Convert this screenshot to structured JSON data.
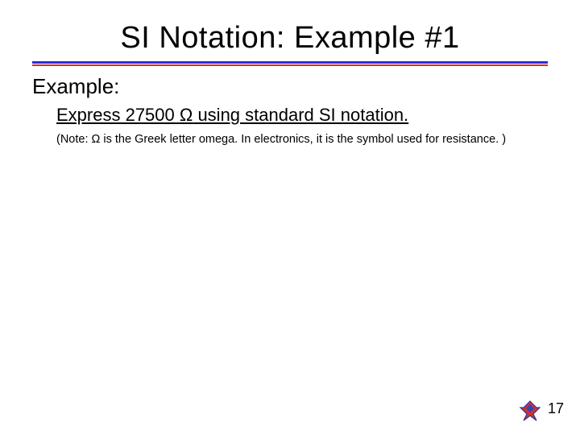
{
  "title": "SI Notation: Example #1",
  "example_label": "Example:",
  "prompt_prefix": "Express 27500 ",
  "prompt_omega": "Ω",
  "prompt_suffix": " using standard SI notation.",
  "note_prefix": "(Note: ",
  "note_omega": "Ω",
  "note_suffix": " is the Greek letter omega. In electronics, it is the symbol used for resistance. )",
  "page_number": "17"
}
